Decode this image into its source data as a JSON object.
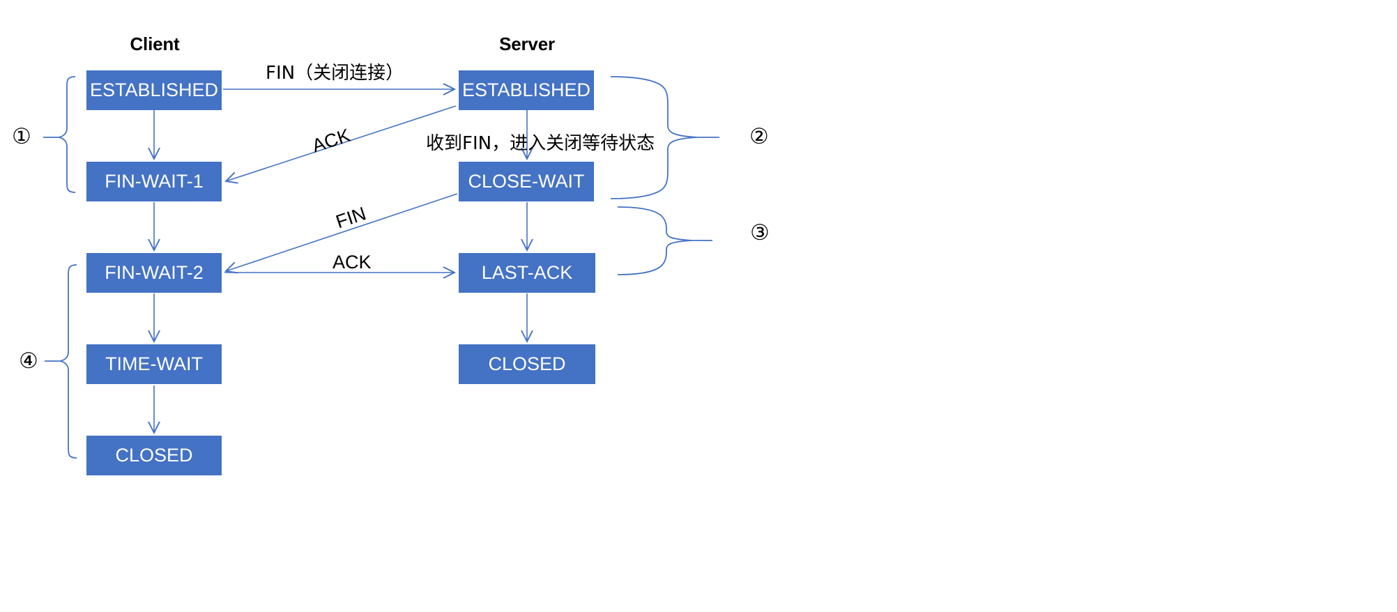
{
  "diagram": {
    "title": "TCP Four-Way Handshake (Connection Termination)",
    "accent_color": "#4472c4",
    "box_fill": "#4472c4",
    "box_text_color": "#ffffff",
    "line_color": "#4472c4",
    "text_color": "#000000",
    "background": "#ffffff"
  },
  "columns": [
    {
      "id": "client",
      "label": "Client"
    },
    {
      "id": "server",
      "label": "Server"
    }
  ],
  "client_states": [
    {
      "id": "client-established",
      "label": "ESTABLISHED"
    },
    {
      "id": "client-fin-wait-1",
      "label": "FIN-WAIT-1"
    },
    {
      "id": "client-fin-wait-2",
      "label": "FIN-WAIT-2"
    },
    {
      "id": "client-time-wait",
      "label": "TIME-WAIT"
    },
    {
      "id": "client-closed",
      "label": "CLOSED"
    }
  ],
  "server_states": [
    {
      "id": "server-established",
      "label": "ESTABLISHED"
    },
    {
      "id": "server-close-wait",
      "label": "CLOSE-WAIT"
    },
    {
      "id": "server-last-ack",
      "label": "LAST-ACK"
    },
    {
      "id": "server-closed",
      "label": "CLOSED"
    }
  ],
  "messages": [
    {
      "id": "msg-fin-close",
      "label": "FIN（关闭连接）",
      "from": "client-established",
      "to": "server-established"
    },
    {
      "id": "msg-ack-1",
      "label": "ACK",
      "from": "server-established",
      "to": "client-fin-wait-1"
    },
    {
      "id": "msg-fin-2",
      "label": "FIN",
      "from": "server-close-wait",
      "to": "client-fin-wait-2"
    },
    {
      "id": "msg-ack-2",
      "label": "ACK",
      "from": "client-fin-wait-2",
      "to": "server-last-ack"
    }
  ],
  "annotations": [
    {
      "id": "note-close-wait",
      "label": "收到FIN，进入关闭等待状态"
    }
  ],
  "step_markers": [
    {
      "id": "step-1",
      "label": "①"
    },
    {
      "id": "step-2",
      "label": "②"
    },
    {
      "id": "step-3",
      "label": "③"
    },
    {
      "id": "step-4",
      "label": "④"
    }
  ]
}
